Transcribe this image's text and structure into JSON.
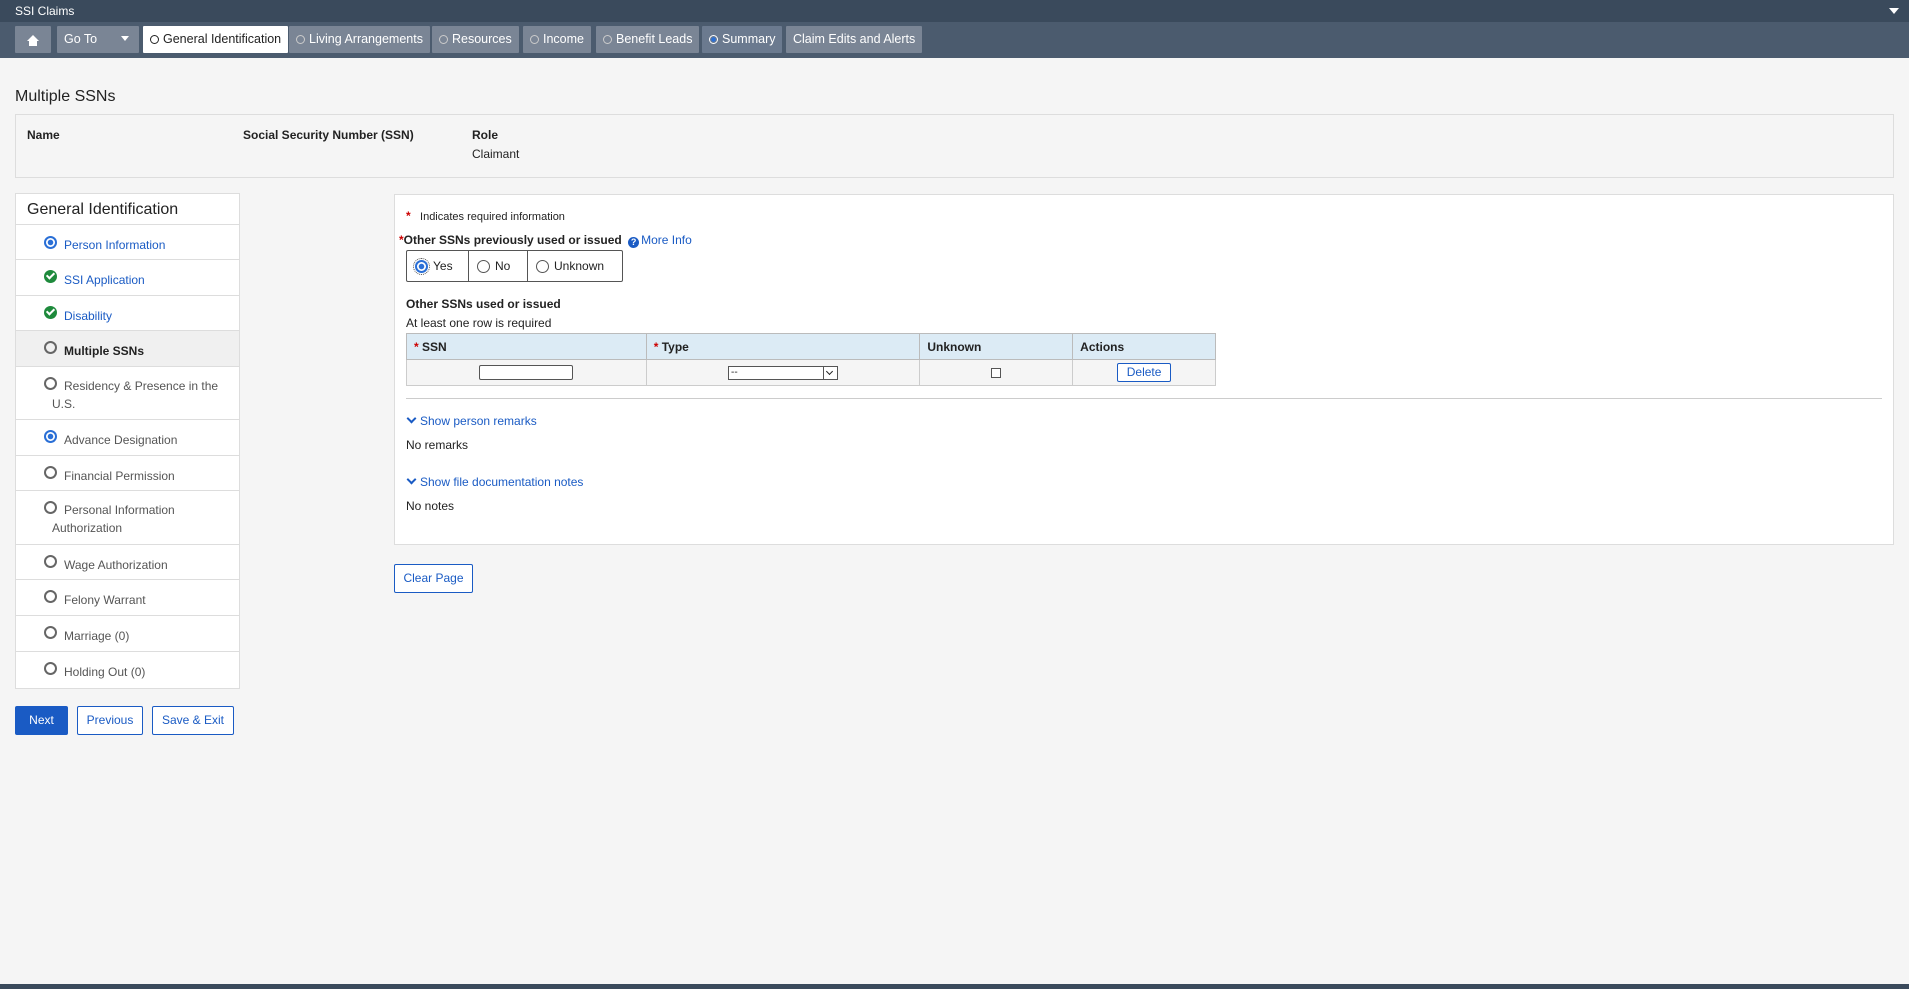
{
  "app": {
    "title": "SSI Claims"
  },
  "nav": {
    "goto_label": "Go To",
    "tabs": [
      {
        "label": "General Identification",
        "state": "active"
      },
      {
        "label": "Living Arrangements",
        "state": "not-started"
      },
      {
        "label": "Resources",
        "state": "not-started"
      },
      {
        "label": "Income",
        "state": "not-started"
      },
      {
        "label": "Benefit Leads",
        "state": "not-started"
      },
      {
        "label": "Summary",
        "state": "in-progress"
      },
      {
        "label": "Claim Edits and Alerts",
        "state": "none"
      }
    ]
  },
  "page": {
    "title": "Multiple SSNs"
  },
  "person": {
    "name_header": "Name",
    "ssn_header": "Social Security Number (SSN)",
    "role_header": "Role",
    "role_value": "Claimant"
  },
  "sidebar": {
    "title": "General Identification",
    "items": [
      {
        "label": "Person Information",
        "status": "in-progress"
      },
      {
        "label": "SSI Application",
        "status": "complete"
      },
      {
        "label": "Disability",
        "status": "complete"
      },
      {
        "label": "Multiple SSNs",
        "status": "current"
      },
      {
        "label": "Residency & Presence in the U.S.",
        "status": "not-started"
      },
      {
        "label": "Advance Designation",
        "status": "in-progress"
      },
      {
        "label": "Financial Permission",
        "status": "not-started"
      },
      {
        "label": "Personal Information Authorization",
        "status": "not-started"
      },
      {
        "label": "Wage Authorization",
        "status": "not-started"
      },
      {
        "label": "Felony Warrant",
        "status": "not-started"
      },
      {
        "label": "Marriage (0)",
        "status": "not-started"
      },
      {
        "label": "Holding Out (0)",
        "status": "not-started"
      }
    ]
  },
  "buttons": {
    "next": "Next",
    "previous": "Previous",
    "save_exit": "Save & Exit",
    "clear_page": "Clear Page"
  },
  "form": {
    "required_marker": "*",
    "required_note": "Indicates required information",
    "question": "Other SSNs previously used or issued",
    "more_info": "More Info",
    "options": [
      "Yes",
      "No",
      "Unknown"
    ],
    "selected": "Yes",
    "table_title": "Other SSNs used or issued",
    "table_note": "At least one row is required",
    "columns": [
      "SSN",
      "Type",
      "Unknown",
      "Actions"
    ],
    "row": {
      "ssn_value": "",
      "type_value": "--",
      "unknown_checked": false,
      "delete_label": "Delete"
    },
    "remarks_link": "Show person remarks",
    "remarks_value": "No remarks",
    "notes_link": "Show file documentation notes",
    "notes_value": "No notes"
  },
  "colors": {
    "accent": "#1a5bc4",
    "header_bg": "#3a4a5c",
    "nav_bg": "#4b5b6e",
    "complete": "#1e8a3c"
  }
}
